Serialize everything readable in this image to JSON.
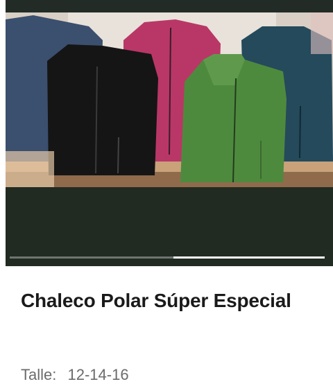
{
  "gallery": {
    "image_alt": "fleece vests product photo",
    "slide_progress": {
      "start": 0.52,
      "end": 1.0
    }
  },
  "product": {
    "title": "Chaleco Polar Súper Especial",
    "size_label": "Talle:",
    "size_value": "12-14-16"
  }
}
